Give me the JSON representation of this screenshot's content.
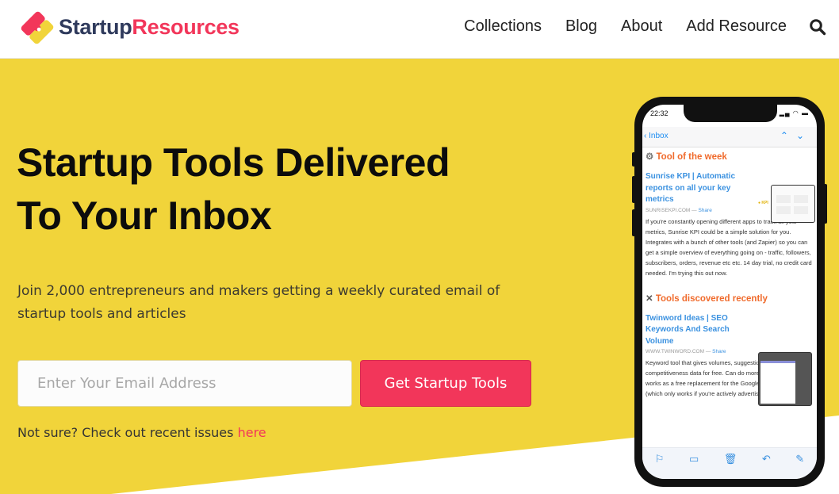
{
  "header": {
    "logo": {
      "part1": "Startup",
      "part2": "Resources"
    },
    "nav": [
      {
        "label": "Collections"
      },
      {
        "label": "Blog"
      },
      {
        "label": "About"
      },
      {
        "label": "Add Resource"
      }
    ],
    "search_icon": "search-icon"
  },
  "hero": {
    "title_line1": "Startup Tools Delivered",
    "title_line2": "To Your Inbox",
    "subtitle": "Join 2,000 entrepreneurs and makers getting a weekly curated email of startup tools and articles",
    "email_placeholder": "Enter Your Email Address",
    "email_value": "",
    "cta_label": "Get Startup Tools",
    "note_text": "Not sure? Check out recent issues ",
    "note_link": "here"
  },
  "colors": {
    "brand_yellow": "#f1d43a",
    "brand_red": "#f2365a",
    "brand_navy": "#2f3a5c"
  },
  "phone": {
    "time": "22:32",
    "back_label": "Inbox",
    "sections": [
      {
        "icon": "gear-icon",
        "heading": "Tool of the week",
        "item": {
          "title": "Sunrise KPI | Automatic reports on all your key metrics",
          "source": "SUNRISEKPI.COM",
          "share": "Share",
          "description": "If you're constantly opening different apps to track all your metrics, Sunrise KPI could be a simple solution for you. Integrates with a bunch of other tools (and Zapier) so you can get a simple overview of everything going on - traffic, followers, subscribers, orders, revenue etc etc. 14 day trial, no credit card needed. I'm trying this out now."
        }
      },
      {
        "icon": "tools-icon",
        "heading": "Tools discovered recently",
        "item": {
          "title": "Twinword Ideas | SEO Keywords And Search Volume",
          "source": "WWW.TWINWORD.COM",
          "share": "Share",
          "description": "Keyword tool that gives volumes, suggestions and competitiveness data for free. Can do more on a paid plan but works as a free replacement for the Google keyword planner (which only works if you're actively advertising on Google)."
        }
      }
    ],
    "toolbar": [
      "flag-icon",
      "folder-icon",
      "trash-icon",
      "reply-icon",
      "compose-icon"
    ]
  }
}
